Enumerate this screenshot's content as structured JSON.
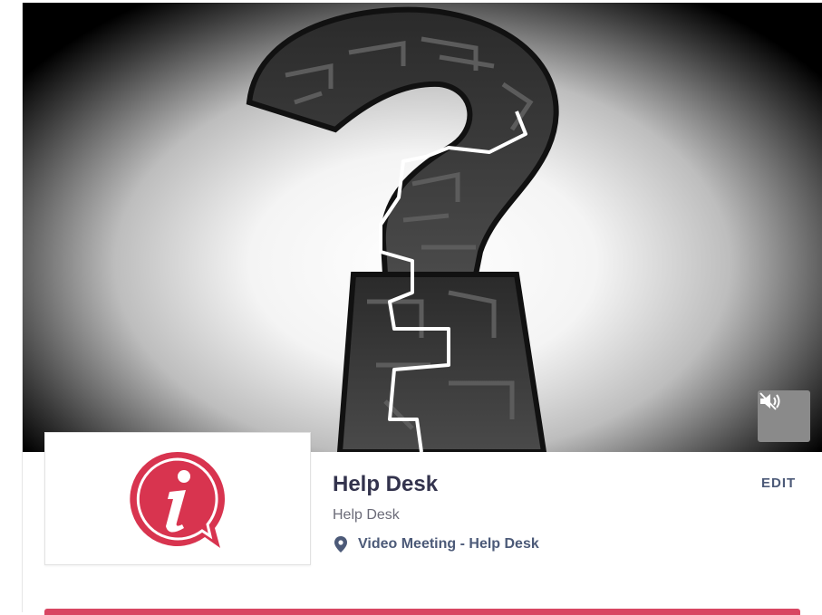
{
  "event": {
    "title": "Help Desk",
    "subtitle": "Help Desk",
    "location": "Video Meeting - Help Desk",
    "edit_label": "EDIT"
  },
  "cover": {
    "image": "question-mark-maze",
    "mute_icon": "speaker-muted-icon"
  },
  "logo": {
    "icon": "info-speech-bubble-icon",
    "letter": "i",
    "color": "#d8344f"
  },
  "colors": {
    "title": "#33334d",
    "link": "#4c5a78",
    "accent": "#d84662"
  }
}
